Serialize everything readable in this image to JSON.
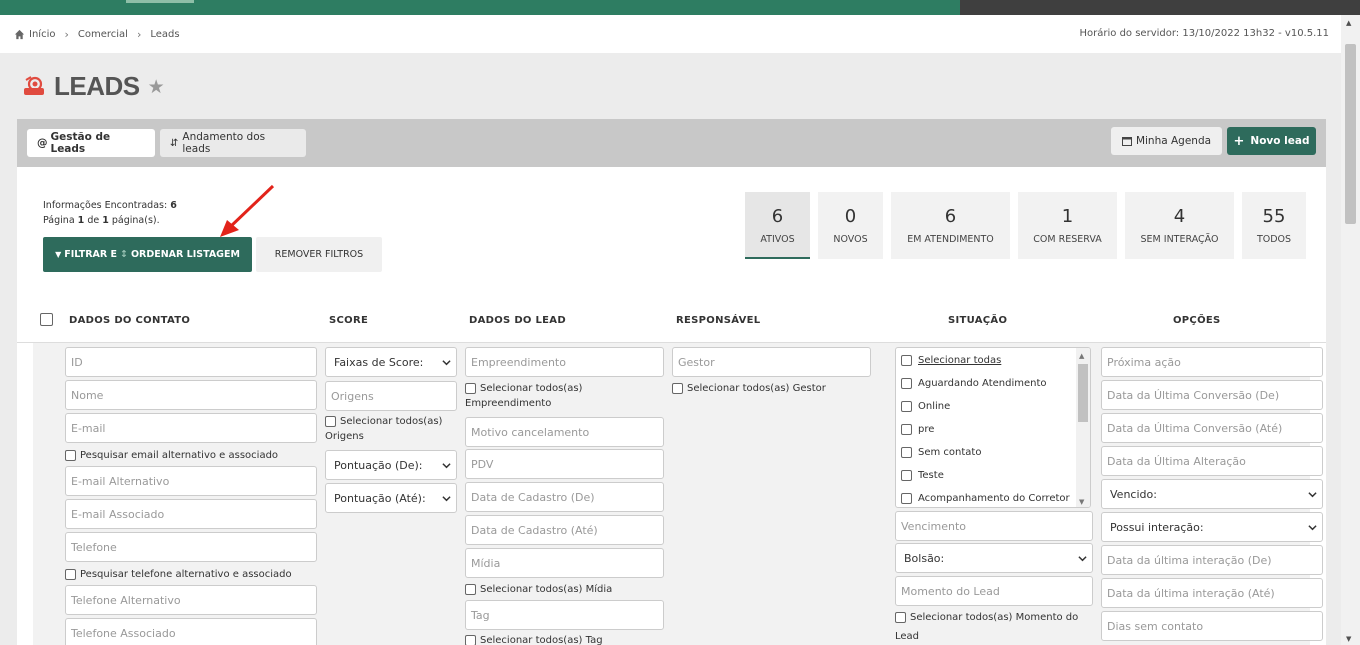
{
  "breadcrumb": {
    "home": "Início",
    "commercial": "Comercial",
    "leads": "Leads"
  },
  "server_time": "Horário do servidor: 13/10/2022 13h32 - v10.5.11",
  "page": {
    "title": "LEADS"
  },
  "tabs": [
    {
      "label": "Gestão de Leads"
    },
    {
      "label": "Andamento dos leads"
    }
  ],
  "actions": {
    "agenda": "Minha Agenda",
    "new_lead": "Novo lead"
  },
  "info": {
    "found_label": "Informações Encontradas:",
    "found_count": "6",
    "page_word": "Página",
    "page_num": "1",
    "of_word": "de",
    "total_pages": "1",
    "pages_suffix": "página(s)."
  },
  "buttons": {
    "filter_part1": "FILTRAR E",
    "filter_part2": "ORDENAR LISTAGEM",
    "remove": "REMOVER FILTROS"
  },
  "stats": [
    {
      "num": "6",
      "label": "ATIVOS"
    },
    {
      "num": "0",
      "label": "NOVOS"
    },
    {
      "num": "6",
      "label": "EM ATENDIMENTO"
    },
    {
      "num": "1",
      "label": "COM RESERVA"
    },
    {
      "num": "4",
      "label": "SEM INTERAÇÃO"
    },
    {
      "num": "55",
      "label": "TODOS"
    }
  ],
  "columns": {
    "contato": "DADOS DO CONTATO",
    "score": "SCORE",
    "lead": "DADOS DO LEAD",
    "responsavel": "RESPONSÁVEL",
    "situacao": "SITUAÇÃO",
    "opcoes": "OPÇÕES"
  },
  "contato": {
    "id": "ID",
    "nome": "Nome",
    "email": "E-mail",
    "email_chk": "Pesquisar email alternativo e associado",
    "email_alt": "E-mail Alternativo",
    "email_assoc": "E-mail Associado",
    "telefone": "Telefone",
    "tel_chk": "Pesquisar telefone alternativo e associado",
    "tel_alt": "Telefone Alternativo",
    "tel_assoc": "Telefone Associado"
  },
  "score": {
    "faixas": "Faixas de Score:",
    "origens": "Origens",
    "origens_chk": "Selecionar todos(as)",
    "origens_chk2": "Origens",
    "pont_de": "Pontuação (De):",
    "pont_ate": "Pontuação (Até):"
  },
  "lead": {
    "empreendimento": "Empreendimento",
    "emp_chk": "Selecionar todos(as)",
    "emp_chk2": "Empreendimento",
    "motivo": "Motivo cancelamento",
    "pdv": "PDV",
    "cad_de": "Data de Cadastro (De)",
    "cad_ate": "Data de Cadastro (Até)",
    "midia": "Mídia",
    "midia_chk": "Selecionar todos(as) Mídia",
    "tag": "Tag",
    "tag_chk": "Selecionar todos(as) Tag"
  },
  "responsavel": {
    "gestor": "Gestor",
    "gestor_chk": "Selecionar todos(as) Gestor"
  },
  "situacao": {
    "items": [
      "Selecionar todas",
      "Aguardando Atendimento",
      "Online",
      "pre",
      "Sem contato",
      "Teste",
      "Acompanhamento do Corretor"
    ],
    "vencimento": "Vencimento",
    "bolsao": "Bolsão:",
    "momento": "Momento do Lead",
    "momento_chk": "Selecionar todos(as) Momento do",
    "momento_chk2": "Lead"
  },
  "opcoes": {
    "proxima": "Próxima ação",
    "conv_de": "Data da Última Conversão (De)",
    "conv_ate": "Data da Última Conversão (Até)",
    "alteracao": "Data da Última Alteração",
    "vencido": "Vencido:",
    "interacao": "Possui interação:",
    "inter_de": "Data da última interação (De)",
    "inter_ate": "Data da última interação (Até)",
    "dias": "Dias sem contato"
  },
  "colors": {
    "primary": "#2e6b5c",
    "brand_bar": "#2e7d62",
    "icon_red": "#e04b3f"
  }
}
